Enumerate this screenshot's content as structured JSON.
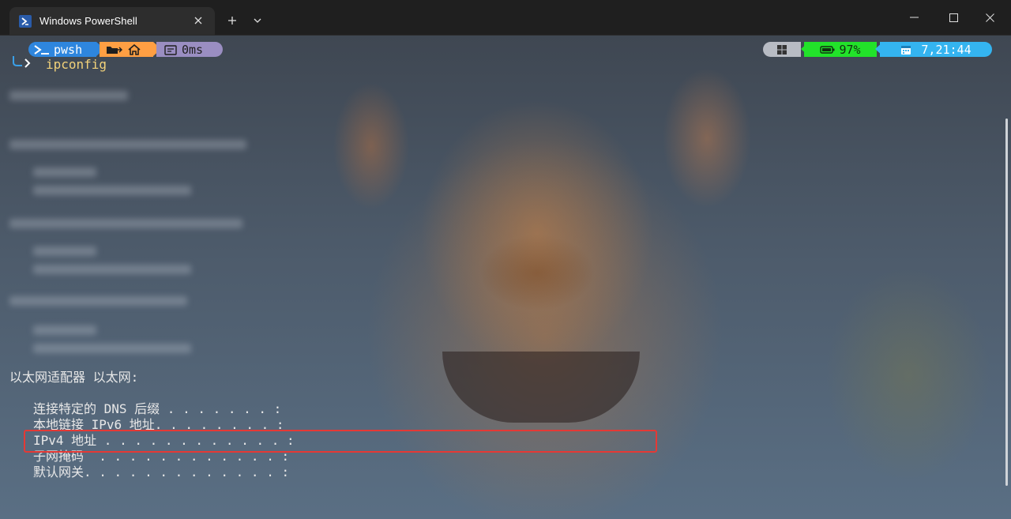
{
  "window": {
    "tab_title": "Windows PowerShell",
    "new_tab_label": "+",
    "minimize_label": "–",
    "maximize_label": "□",
    "close_label": "✕"
  },
  "prompt": {
    "shell": "pwsh",
    "exec_time": "0ms",
    "battery": "97%",
    "clock": "7,21:44",
    "command": "ipconfig"
  },
  "output": {
    "adapter_header": "以太网适配器 以太网:",
    "lines": [
      "连接特定的 DNS 后缀 . . . . . . . :",
      "本地链接 IPv6 地址. . . . . . . . :",
      "IPv4 地址 . . . . . . . . . . . . :",
      "子网掩码  . . . . . . . . . . . . :",
      "默认网关. . . . . . . . . . . . . :"
    ]
  },
  "colors": {
    "pwsh_segment": "#2e86de",
    "path_segment": "#ff9f43",
    "time_segment": "#9a8ec2",
    "battery_segment": "#22e22a",
    "clock_segment": "#34b4f0",
    "command_text": "#f2d27a",
    "highlight_box": "#e53935"
  },
  "icons": [
    "powershell-icon",
    "folder-icon",
    "home-icon",
    "stopwatch-icon",
    "windows-icon",
    "battery-icon",
    "calendar-icon"
  ]
}
